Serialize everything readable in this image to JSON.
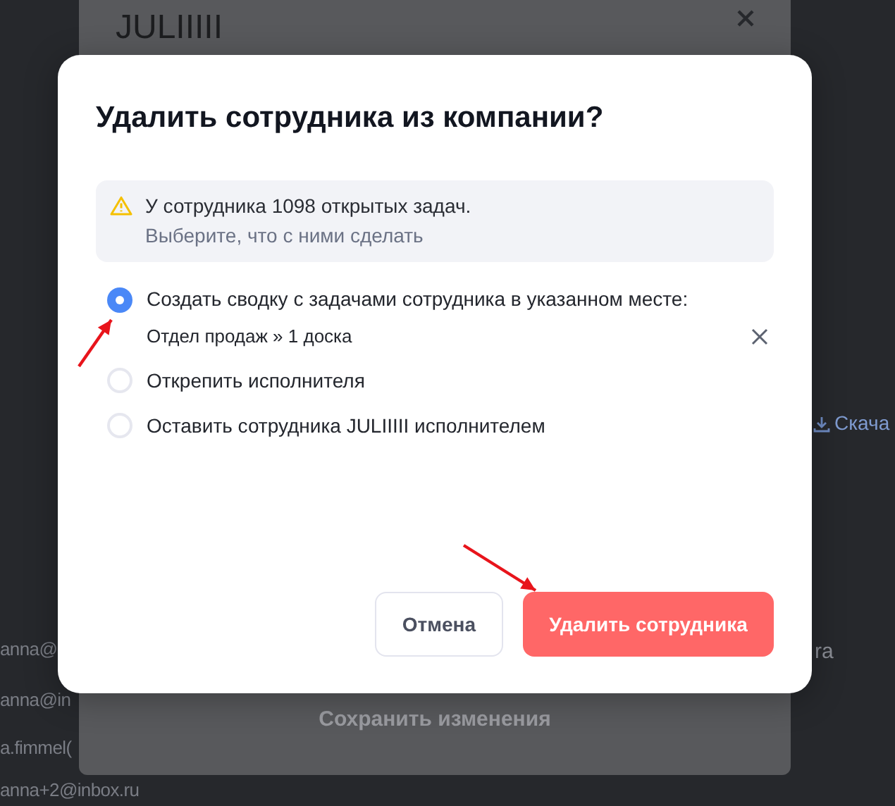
{
  "background": {
    "emails": [
      "anna@",
      "anna@in",
      "a.fimmel(",
      "anna+2@inbox.ru"
    ],
    "download_link": "Скача",
    "side_text": "ra"
  },
  "panel": {
    "title": "JULIIIII",
    "save_button": "Сохранить изменения"
  },
  "dialog": {
    "title": "Удалить сотрудника из компании?",
    "warning": {
      "line_1": "У сотрудника 1098 открытых задач.",
      "line_2": "Выберите, что с ними сделать"
    },
    "options": [
      {
        "label": "Создать сводку с задачами сотрудника в указанном месте:",
        "selected": true,
        "target": "Отдел продаж » 1 доска"
      },
      {
        "label": "Открепить исполнителя",
        "selected": false
      },
      {
        "label": "Оставить сотрудника JULIIIII исполнителем",
        "selected": false
      }
    ],
    "buttons": [
      {
        "label": "Отмена",
        "kind": "secondary"
      },
      {
        "label": "Удалить сотрудника",
        "kind": "danger"
      }
    ]
  }
}
